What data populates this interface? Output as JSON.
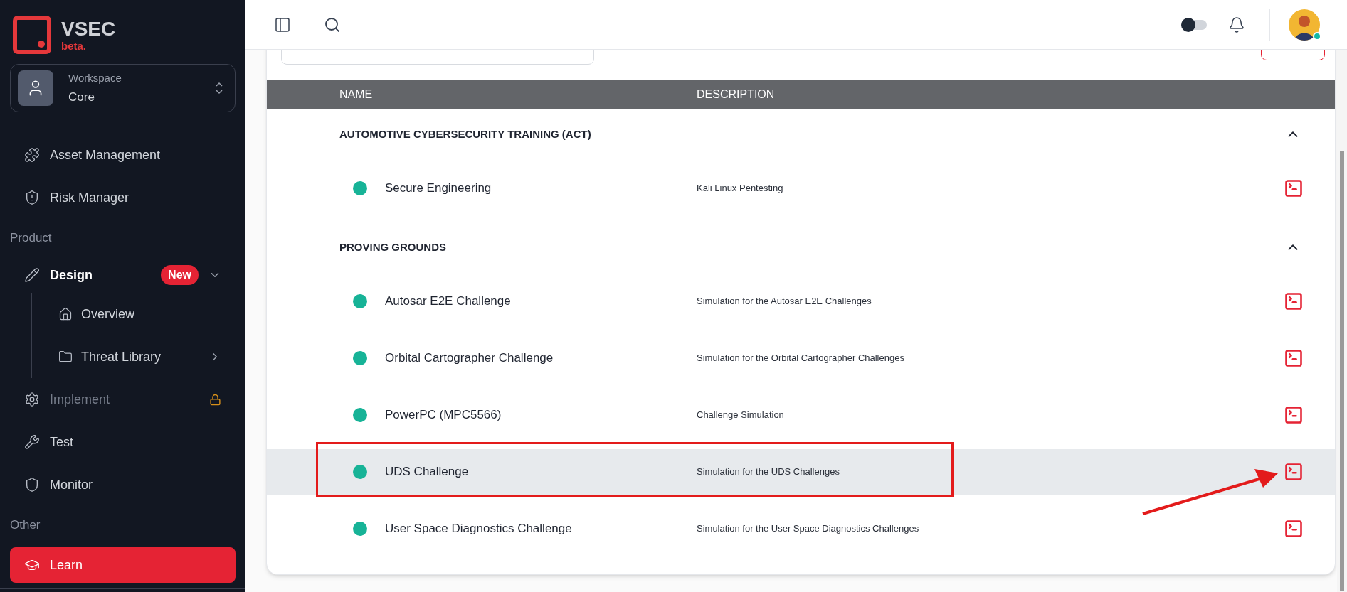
{
  "sidebar": {
    "logo": {
      "name": "VSEC",
      "tag": "beta."
    },
    "workspace": {
      "label": "Workspace",
      "value": "Core"
    },
    "nav": [
      {
        "kind": "link",
        "label": "Asset Management",
        "selected": false,
        "locked": false
      },
      {
        "kind": "link",
        "label": "Risk Manager",
        "selected": false,
        "locked": false
      },
      {
        "kind": "heading",
        "label": "Product"
      },
      {
        "kind": "link",
        "label": "Design",
        "selected": false,
        "locked": false,
        "badge": "New",
        "expanded": true,
        "children": [
          {
            "label": "Overview",
            "selected": false
          },
          {
            "label": "Threat Library",
            "selected": false,
            "expanded": false
          }
        ]
      },
      {
        "kind": "link",
        "label": "Implement",
        "selected": false,
        "locked": true
      },
      {
        "kind": "link",
        "label": "Test",
        "selected": false,
        "locked": false
      },
      {
        "kind": "link",
        "label": "Monitor",
        "selected": false,
        "locked": false
      },
      {
        "kind": "heading",
        "label": "Other"
      },
      {
        "kind": "link",
        "label": "Learn",
        "selected": true,
        "locked": false
      }
    ]
  },
  "header": {
    "theme_toggle": {
      "on": false
    },
    "avatar": {
      "online": true
    }
  },
  "table": {
    "columns": [
      "NAME",
      "DESCRIPTION"
    ],
    "groups": [
      {
        "title": "AUTOMOTIVE CYBERSECURITY TRAINING (ACT)",
        "expanded": true,
        "rows": [
          {
            "name": "Secure Engineering",
            "description": "Kali Linux Pentesting",
            "selected": false
          }
        ]
      },
      {
        "title": "PROVING GROUNDS",
        "expanded": true,
        "rows": [
          {
            "name": "Autosar E2E Challenge",
            "description": "Simulation for the Autosar E2E Challenges",
            "selected": false
          },
          {
            "name": "Orbital Cartographer Challenge",
            "description": "Simulation for the Orbital Cartographer Challenges",
            "selected": false
          },
          {
            "name": "PowerPC (MPC5566)",
            "description": "Challenge Simulation",
            "selected": false
          },
          {
            "name": "UDS Challenge",
            "description": "Simulation for the UDS Challenges",
            "selected": true
          },
          {
            "name": "User Space Diagnostics Challenge",
            "description": "Simulation for the User Space Diagnostics Challenges",
            "selected": false
          }
        ]
      }
    ]
  }
}
